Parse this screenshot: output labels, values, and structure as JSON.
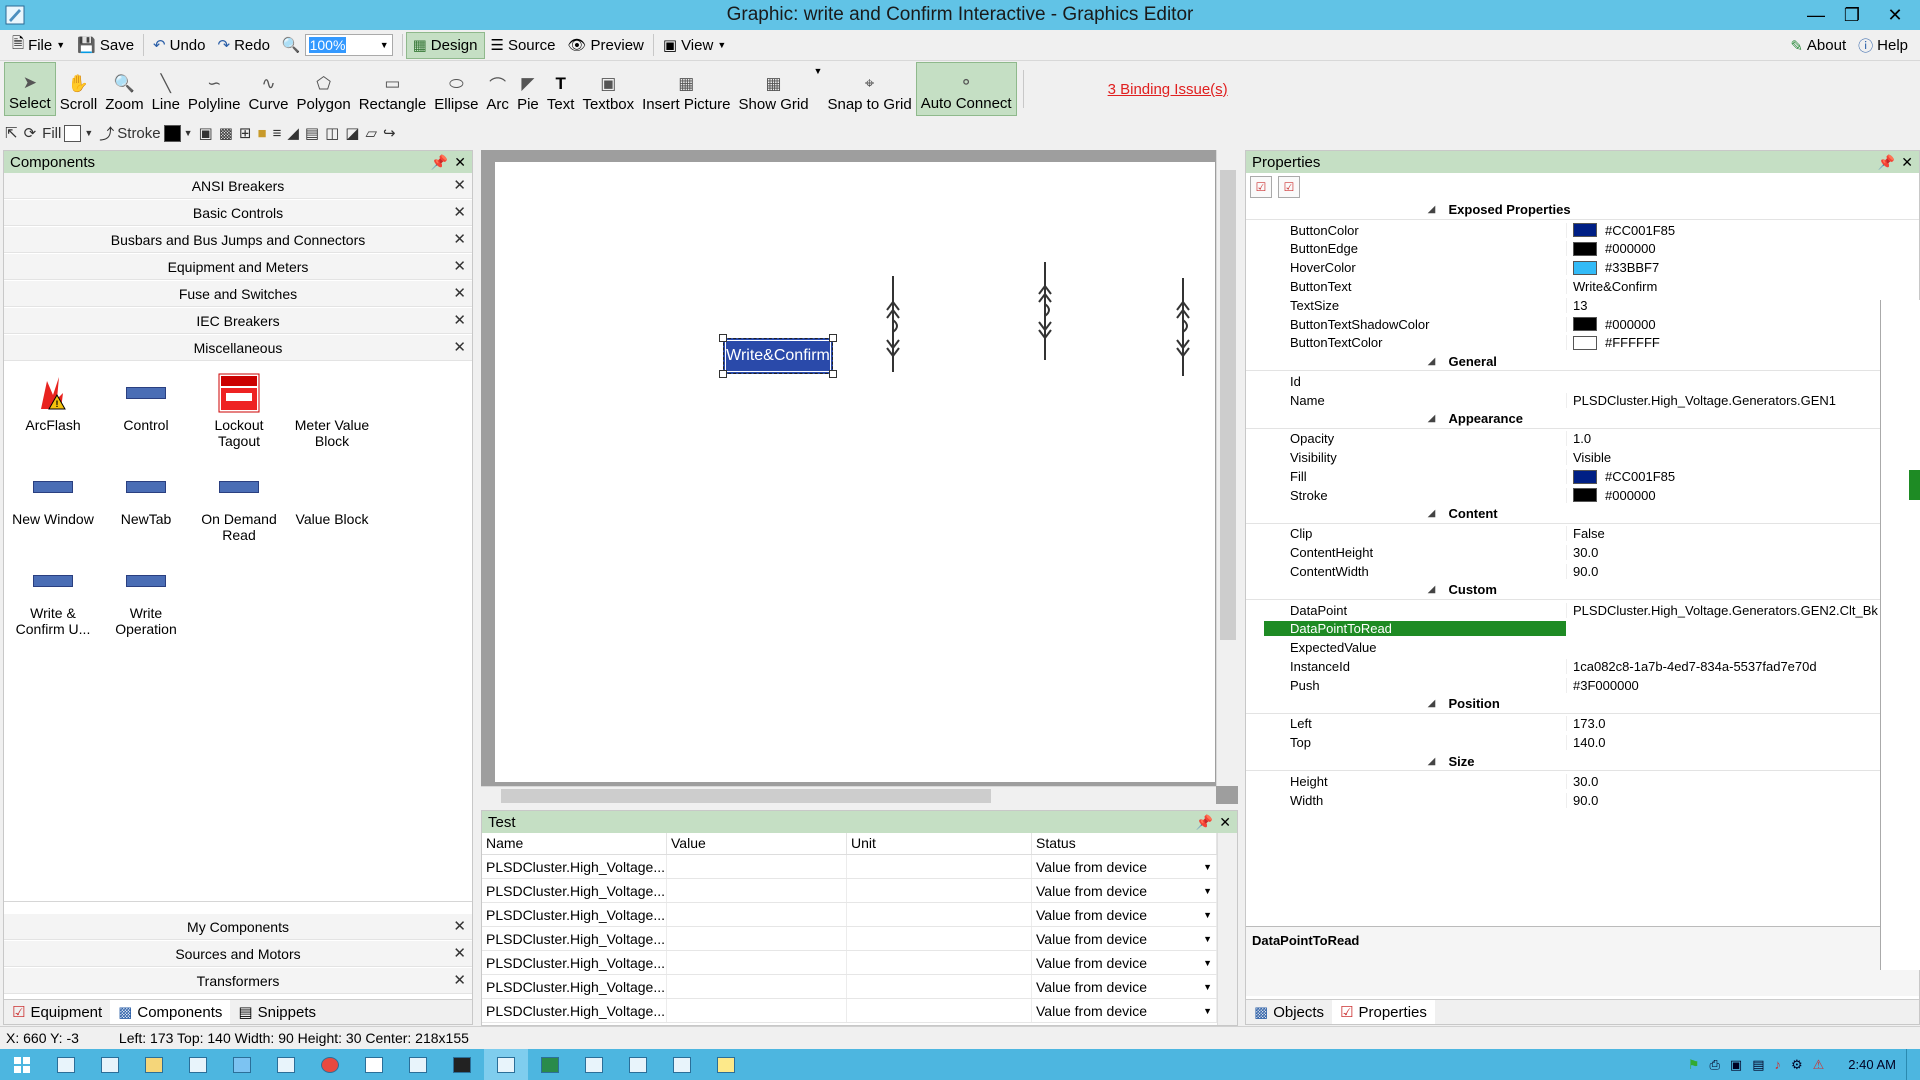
{
  "window": {
    "title": "Graphic: write and Confirm Interactive - Graphics Editor"
  },
  "menubar": {
    "file": "File",
    "save": "Save",
    "undo": "Undo",
    "redo": "Redo",
    "zoom": "100%",
    "design": "Design",
    "source": "Source",
    "preview": "Preview",
    "view": "View",
    "about": "About",
    "help": "Help"
  },
  "toolbar": {
    "tools": [
      "Select",
      "Scroll",
      "Zoom",
      "Line",
      "Polyline",
      "Curve",
      "Polygon",
      "Rectangle",
      "Ellipse",
      "Arc",
      "Pie",
      "Text",
      "Textbox",
      "Insert Picture",
      "Show Grid",
      "Snap to Grid",
      "Auto Connect"
    ],
    "binding_issues": "3 Binding Issue(s)"
  },
  "toolbar2": {
    "fill": "Fill",
    "stroke": "Stroke"
  },
  "components": {
    "title": "Components",
    "categories": [
      "ANSI Breakers",
      "Basic Controls",
      "Busbars and Bus Jumps and Connectors",
      "Equipment and Meters",
      "Fuse and Switches",
      "IEC Breakers",
      "Miscellaneous"
    ],
    "items": [
      "ArcFlash",
      "Control",
      "Lockout Tagout",
      "Meter Value Block",
      "New Window",
      "NewTab",
      "On Demand Read",
      "Value Block",
      "Write & Confirm U...",
      "Write Operation"
    ],
    "bottom_categories": [
      "My Components",
      "Sources and Motors",
      "Transformers"
    ],
    "tabs": [
      "Equipment",
      "Components",
      "Snippets"
    ]
  },
  "canvas": {
    "button_text": "Write&Confirm"
  },
  "test": {
    "title": "Test",
    "columns": [
      "Name",
      "Value",
      "Unit",
      "Status"
    ],
    "rows": [
      {
        "name": "PLSDCluster.High_Voltage...",
        "value": "",
        "unit": "",
        "status": "Value from device"
      },
      {
        "name": "PLSDCluster.High_Voltage...",
        "value": "",
        "unit": "",
        "status": "Value from device"
      },
      {
        "name": "PLSDCluster.High_Voltage...",
        "value": "",
        "unit": "",
        "status": "Value from device"
      },
      {
        "name": "PLSDCluster.High_Voltage...",
        "value": "",
        "unit": "",
        "status": "Value from device"
      },
      {
        "name": "PLSDCluster.High_Voltage...",
        "value": "",
        "unit": "",
        "status": "Value from device"
      },
      {
        "name": "PLSDCluster.High_Voltage...",
        "value": "",
        "unit": "",
        "status": "Value from device"
      },
      {
        "name": "PLSDCluster.High_Voltage...",
        "value": "",
        "unit": "",
        "status": "Value from device"
      }
    ]
  },
  "properties": {
    "title": "Properties",
    "rows": [
      {
        "cat": true,
        "name": "Exposed Properties"
      },
      {
        "name": "ButtonColor",
        "value": "#CC001F85",
        "swatch": "#001F85"
      },
      {
        "name": "ButtonEdge",
        "value": "#000000",
        "swatch": "#000000"
      },
      {
        "name": "HoverColor",
        "value": "#33BBF7",
        "swatch": "#33BBF7"
      },
      {
        "name": "ButtonText",
        "value": "Write&Confirm"
      },
      {
        "name": "TextSize",
        "value": "13"
      },
      {
        "name": "ButtonTextShadowColor",
        "value": "#000000",
        "swatch": "#000000"
      },
      {
        "name": "ButtonTextColor",
        "value": "#FFFFFF",
        "swatch": "#FFFFFF"
      },
      {
        "cat": true,
        "name": "General"
      },
      {
        "name": "Id",
        "value": ""
      },
      {
        "name": "Name",
        "value": "PLSDCluster.High_Voltage.Generators.GEN1"
      },
      {
        "cat": true,
        "name": "Appearance"
      },
      {
        "name": "Opacity",
        "value": "1.0"
      },
      {
        "name": "Visibility",
        "value": "Visible"
      },
      {
        "name": "Fill",
        "value": "#CC001F85",
        "swatch": "#001F85"
      },
      {
        "name": "Stroke",
        "value": "#000000",
        "swatch": "#000000"
      },
      {
        "cat": true,
        "name": "Content"
      },
      {
        "name": "Clip",
        "value": "False"
      },
      {
        "name": "ContentHeight",
        "value": "30.0"
      },
      {
        "name": "ContentWidth",
        "value": "90.0"
      },
      {
        "cat": true,
        "name": "Custom"
      },
      {
        "name": "DataPoint",
        "value": "PLSDCluster.High_Voltage.Generators.GEN2.Clt_Bk"
      },
      {
        "name": "DataPointToRead",
        "value": "",
        "selected": true
      },
      {
        "name": "ExpectedValue",
        "value": ""
      },
      {
        "name": "InstanceId",
        "value": "1ca082c8-1a7b-4ed7-834a-5537fad7e70d"
      },
      {
        "name": "Push",
        "value": "#3F000000"
      },
      {
        "cat": true,
        "name": "Position"
      },
      {
        "name": "Left",
        "value": "173.0"
      },
      {
        "name": "Top",
        "value": "140.0"
      },
      {
        "cat": true,
        "name": "Size"
      },
      {
        "name": "Height",
        "value": "30.0"
      },
      {
        "name": "Width",
        "value": "90.0"
      }
    ],
    "description": "DataPointToRead",
    "tabs": [
      "Objects",
      "Properties"
    ]
  },
  "statusbar": {
    "coords": "X: 660  Y: -3",
    "geometry": "Left: 173  Top: 140  Width: 90  Height: 30  Center: 218x155"
  },
  "taskbar": {
    "clock": "2:40 AM"
  }
}
